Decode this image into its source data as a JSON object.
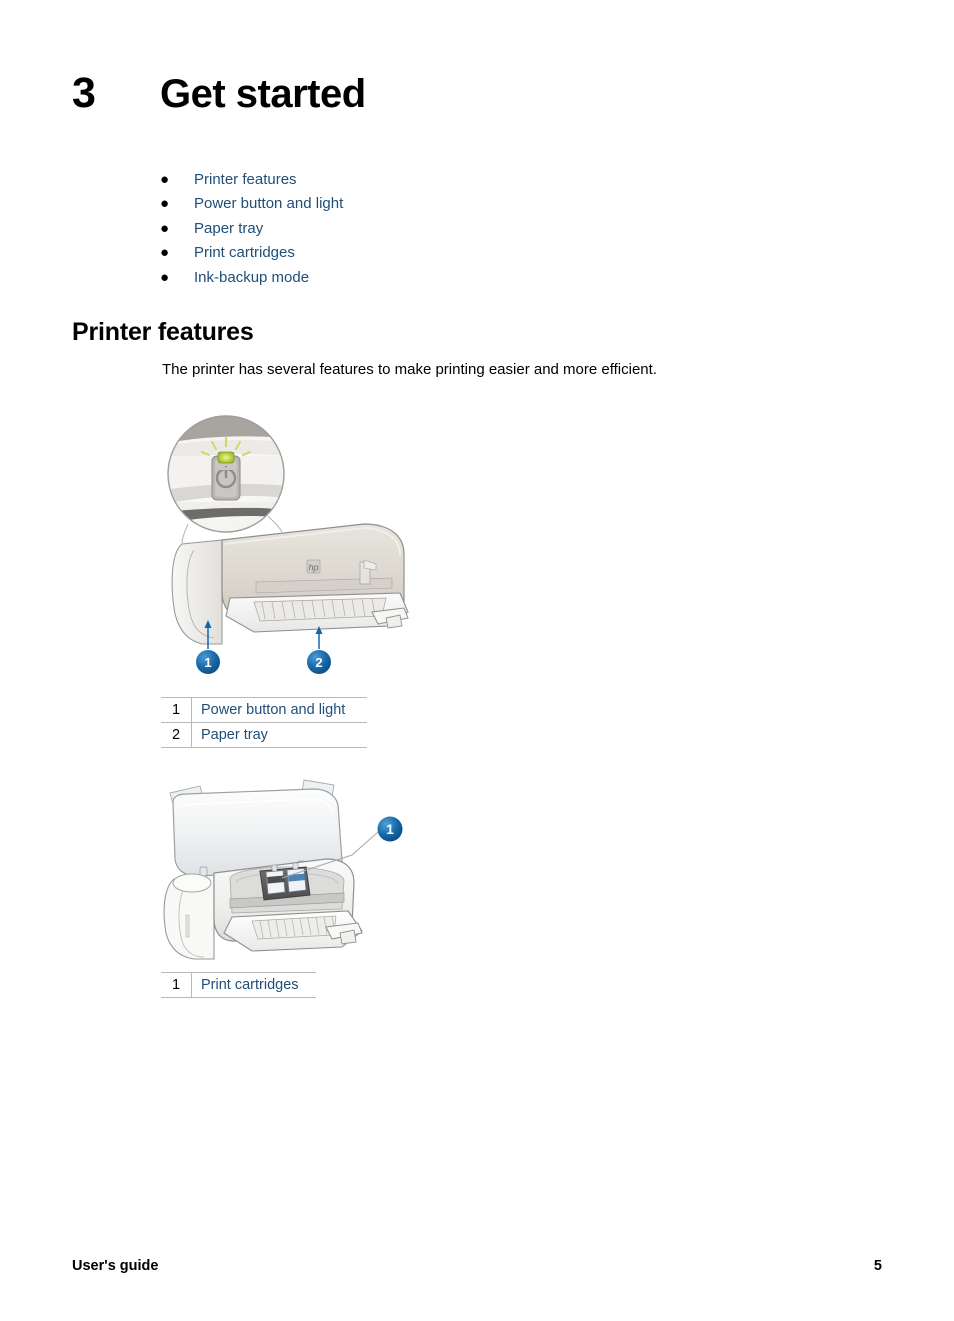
{
  "chapter": {
    "number": "3",
    "title": "Get started"
  },
  "toc": {
    "bullet_glyph": "●",
    "items": [
      {
        "label": "Printer features"
      },
      {
        "label": "Power button and light"
      },
      {
        "label": "Paper tray"
      },
      {
        "label": "Print cartridges"
      },
      {
        "label": "Ink-backup mode"
      }
    ]
  },
  "section": {
    "heading": "Printer features",
    "paragraph": "The printer has several features to make printing easier and more efficient."
  },
  "figure_one": {
    "name": "printer-front-view-with-power-button-magnifier",
    "callouts": [
      {
        "number": "1"
      },
      {
        "number": "2"
      }
    ],
    "logo_text": "hp",
    "legend": {
      "rows": [
        {
          "number": "1",
          "label": "Power button and light"
        },
        {
          "number": "2",
          "label": "Paper tray"
        }
      ]
    }
  },
  "figure_two": {
    "name": "printer-open-cover-with-print-cartridges",
    "callouts": [
      {
        "number": "1"
      }
    ],
    "legend": {
      "rows": [
        {
          "number": "1",
          "label": "Print cartridges"
        }
      ]
    }
  },
  "footer": {
    "left": "User's guide",
    "page_number": "5"
  },
  "colors": {
    "link_blue": "#1f4e79",
    "callout_blue": "#1565a8",
    "printer_body": "#ded9d2",
    "printer_light": "#f4f4f3",
    "outline_grey": "#8d8d8d",
    "table_border": "#b8b8b8",
    "led_green": "#a8c93a"
  }
}
